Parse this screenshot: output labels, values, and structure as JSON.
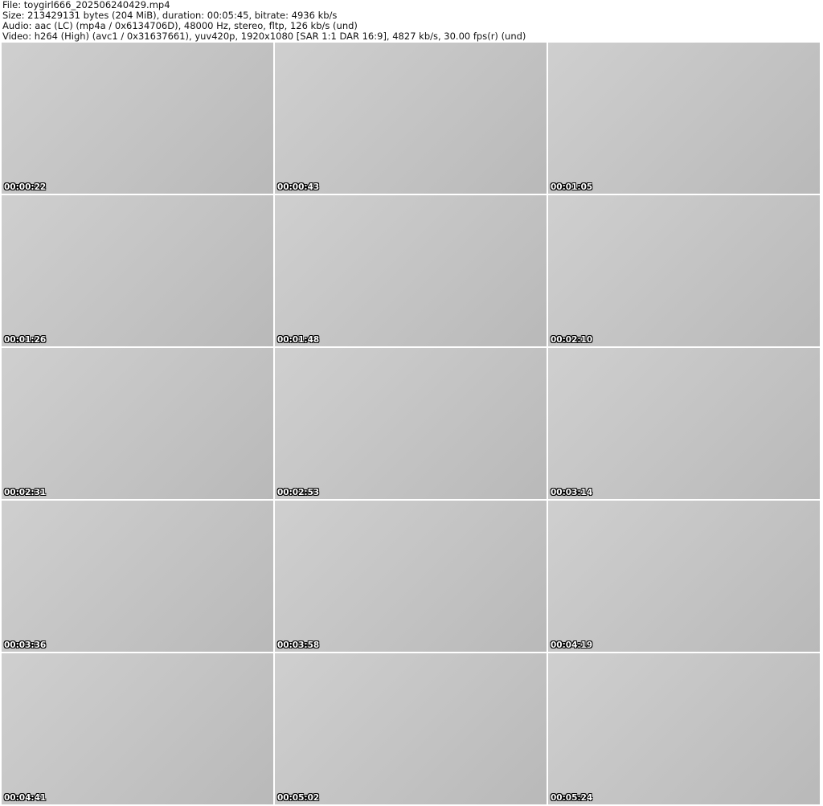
{
  "header": {
    "file": "File: toygirl666_202506240429.mp4",
    "size": "Size: 213429131 bytes (204 MiB), duration: 00:05:45, bitrate: 4936 kb/s",
    "audio": "Audio: aac (LC) (mp4a / 0x6134706D), 48000 Hz, stereo, fltp, 126 kb/s (und)",
    "video": "Video: h264 (High) (avc1 / 0x31637661), yuv420p, 1920x1080 [SAR 1:1 DAR 16:9], 4827 kb/s, 30.00 fps(r) (und)"
  },
  "thumbnails": [
    {
      "timestamp": "00:00:22"
    },
    {
      "timestamp": "00:00:43"
    },
    {
      "timestamp": "00:01:05"
    },
    {
      "timestamp": "00:01:26"
    },
    {
      "timestamp": "00:01:48"
    },
    {
      "timestamp": "00:02:10"
    },
    {
      "timestamp": "00:02:31"
    },
    {
      "timestamp": "00:02:53"
    },
    {
      "timestamp": "00:03:14"
    },
    {
      "timestamp": "00:03:36"
    },
    {
      "timestamp": "00:03:58"
    },
    {
      "timestamp": "00:04:19"
    },
    {
      "timestamp": "00:04:41"
    },
    {
      "timestamp": "00:05:02"
    },
    {
      "timestamp": "00:05:24"
    }
  ]
}
